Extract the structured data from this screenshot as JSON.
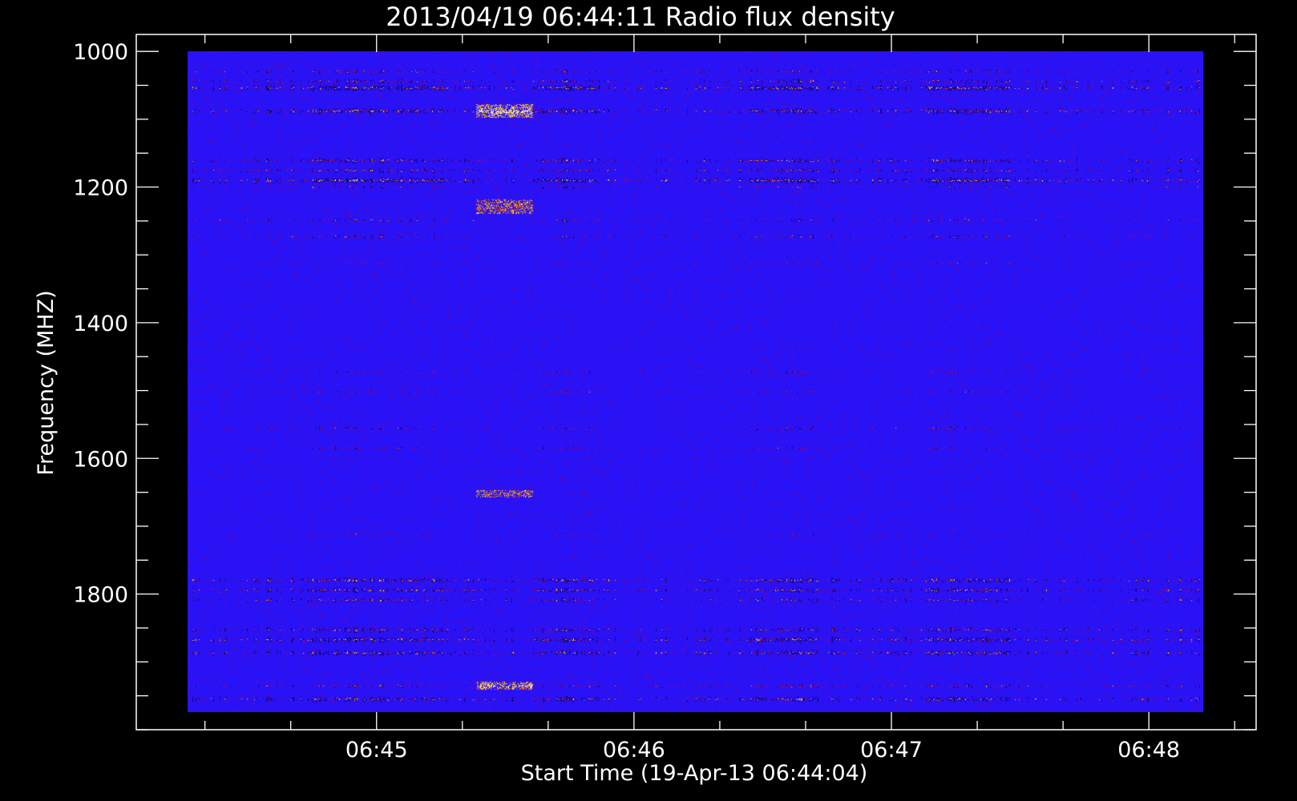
{
  "chart_data": {
    "type": "heatmap",
    "title": "2013/04/19 06:44:11 Radio flux density",
    "xlabel": "Start Time (19-Apr-13 06:44:04)",
    "ylabel": "Frequency (MHZ)",
    "x_range": [
      "06:44:04",
      "06:48:25"
    ],
    "x_major_ticks": [
      "06:45",
      "06:46",
      "06:47",
      "06:48"
    ],
    "x_minor_tick_interval_s": 20,
    "y_range": [
      975,
      2000
    ],
    "y_inverted": true,
    "y_major_ticks": [
      1000,
      1200,
      1400,
      1600,
      1800
    ],
    "y_minor_tick_interval": 50,
    "data_x_range": [
      "06:44:15",
      "06:48:15"
    ],
    "data_y_range": [
      1000,
      2000
    ],
    "grid": false,
    "colors": {
      "background": "#000000",
      "axes": "#ffffff",
      "baseline": "#2a12ff",
      "low": "#000000",
      "mid": "#cc1a00",
      "high": "#ffd200",
      "max": "#ffffff"
    },
    "horizontal_bands_mhz": [
      {
        "freq": 1030,
        "intensity": 0.6
      },
      {
        "freq": 1045,
        "intensity": 0.7
      },
      {
        "freq": 1055,
        "intensity": 1.0
      },
      {
        "freq": 1090,
        "intensity": 0.9
      },
      {
        "freq": 1165,
        "intensity": 0.8
      },
      {
        "freq": 1180,
        "intensity": 0.7
      },
      {
        "freq": 1195,
        "intensity": 1.0
      },
      {
        "freq": 1205,
        "intensity": 0.5
      },
      {
        "freq": 1255,
        "intensity": 0.55
      },
      {
        "freq": 1280,
        "intensity": 0.55
      },
      {
        "freq": 1320,
        "intensity": 0.4
      },
      {
        "freq": 1450,
        "intensity": 0.3
      },
      {
        "freq": 1485,
        "intensity": 0.45
      },
      {
        "freq": 1515,
        "intensity": 0.45
      },
      {
        "freq": 1570,
        "intensity": 0.5
      },
      {
        "freq": 1600,
        "intensity": 0.45
      },
      {
        "freq": 1730,
        "intensity": 0.4
      },
      {
        "freq": 1800,
        "intensity": 0.85
      },
      {
        "freq": 1815,
        "intensity": 0.8
      },
      {
        "freq": 1830,
        "intensity": 0.7
      },
      {
        "freq": 1875,
        "intensity": 0.75
      },
      {
        "freq": 1890,
        "intensity": 0.9
      },
      {
        "freq": 1910,
        "intensity": 0.85
      },
      {
        "freq": 1960,
        "intensity": 0.6
      },
      {
        "freq": 1980,
        "intensity": 0.85
      }
    ],
    "burst_features": [
      {
        "time": "06:45:30",
        "freq_range": [
          1080,
          1100
        ],
        "intensity": 1.0
      },
      {
        "time": "06:45:30",
        "freq_range": [
          1225,
          1245
        ],
        "intensity": 0.9
      },
      {
        "time": "06:45:30",
        "freq_range": [
          1665,
          1675
        ],
        "intensity": 0.9
      },
      {
        "time": "06:45:30",
        "freq_range": [
          1955,
          1965
        ],
        "intensity": 0.9
      }
    ]
  }
}
